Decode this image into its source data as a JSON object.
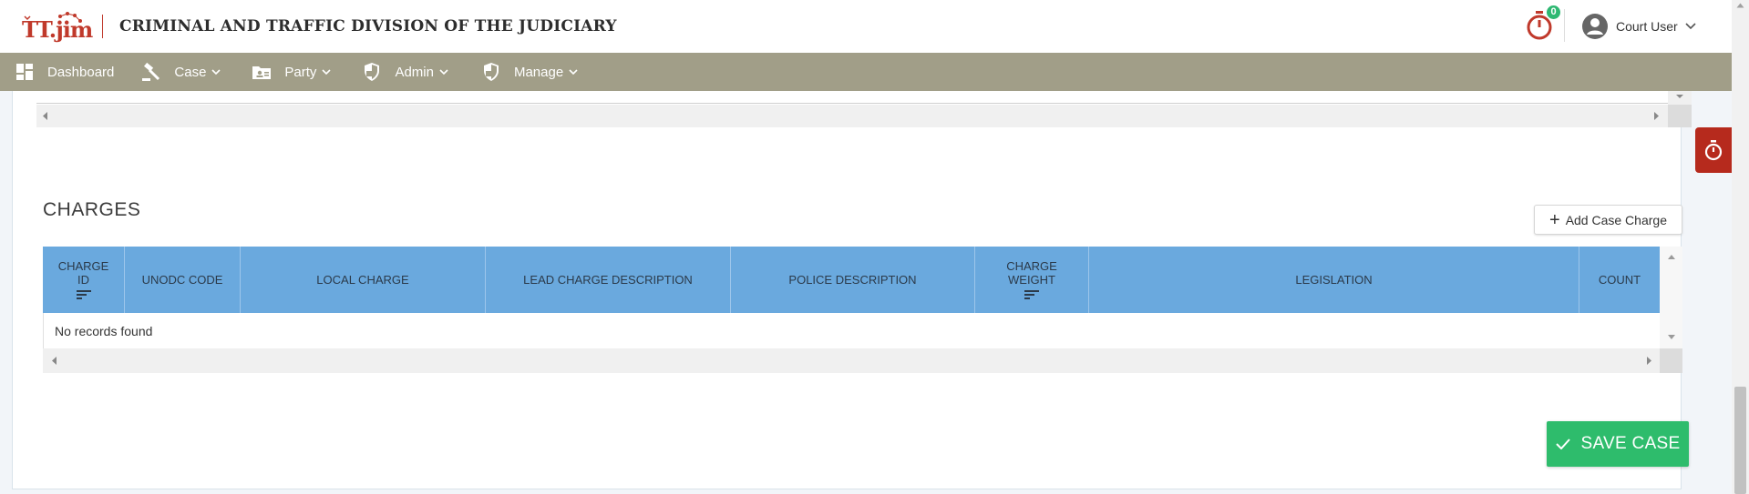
{
  "header": {
    "logo_text": "TT.jim",
    "app_title": "CRIMINAL AND TRAFFIC DIVISION OF THE JUDICIARY",
    "timer_badge_count": "0",
    "user_name": "Court User"
  },
  "nav": {
    "items": [
      {
        "label": "Dashboard",
        "icon": "dashboard-icon"
      },
      {
        "label": "Case",
        "icon": "gavel-icon"
      },
      {
        "label": "Party",
        "icon": "id-card-icon"
      },
      {
        "label": "Admin",
        "icon": "shield-icon"
      },
      {
        "label": "Manage",
        "icon": "shield-icon"
      }
    ]
  },
  "charges": {
    "title": "CHARGES",
    "add_button_label": "Add Case Charge",
    "columns": [
      {
        "label": "CHARGE ID",
        "sortable": true
      },
      {
        "label": "UNODC CODE",
        "sortable": false
      },
      {
        "label": "LOCAL CHARGE",
        "sortable": false
      },
      {
        "label": "LEAD CHARGE DESCRIPTION",
        "sortable": false
      },
      {
        "label": "POLICE DESCRIPTION",
        "sortable": false
      },
      {
        "label": "CHARGE WEIGHT",
        "sortable": true
      },
      {
        "label": "LEGISLATION",
        "sortable": false
      },
      {
        "label": "COUNT",
        "sortable": false
      }
    ],
    "empty_message": "No records found"
  },
  "footer": {
    "save_label": "SAVE CASE"
  },
  "colors": {
    "nav_bg": "#a19e88",
    "grid_header_bg": "#6aa9de",
    "save_bg": "#2ebc6c",
    "brand_red": "#c0392b",
    "timer_tab_bg": "#b62a1d"
  }
}
